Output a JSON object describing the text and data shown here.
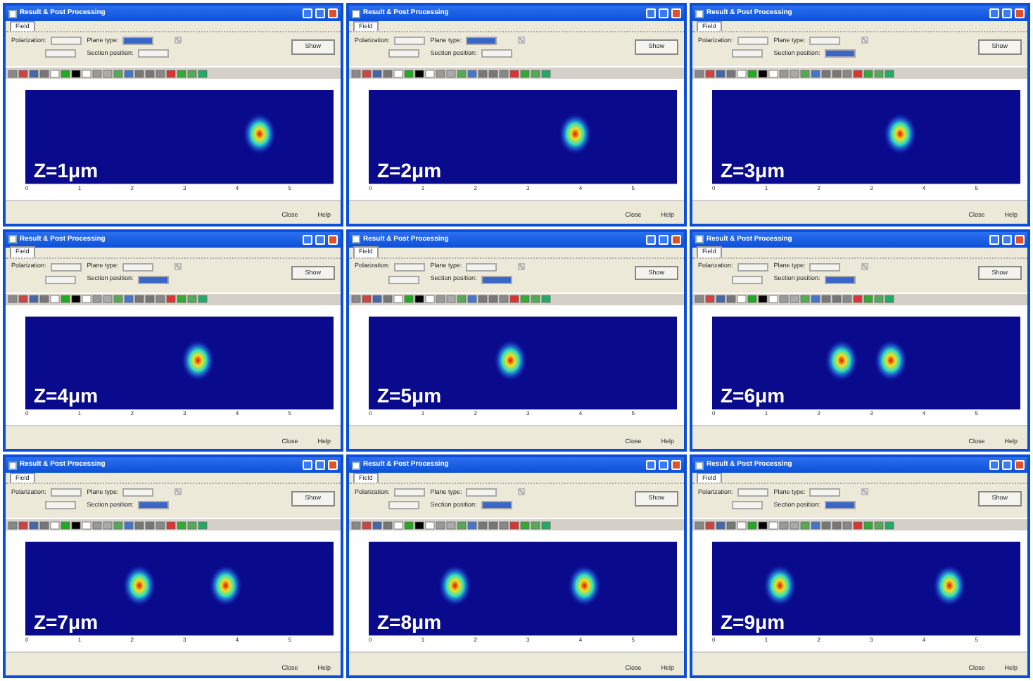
{
  "windows": [
    {
      "title": "Result & Post Processing",
      "tabs": [
        {
          "label": "Field",
          "selected": true
        }
      ],
      "polarization_label": "Polarization:",
      "plane_type_label": "Plane type:",
      "plane_type_field": {
        "focused": true
      },
      "section_position_label": "Section position:",
      "section_position_field": {
        "focused": false
      },
      "checkbox": {
        "checked": true,
        "disabled": true
      },
      "show_button": "Show",
      "overlay": "Z=1μm",
      "x_ticks": [
        "0",
        "1",
        "2",
        "3",
        "4",
        "5"
      ],
      "close_button": "Close",
      "help_button": "Help"
    },
    {
      "title": "Result & Post Processing",
      "tabs": [
        {
          "label": "Field",
          "selected": true
        }
      ],
      "polarization_label": "Polarization:",
      "plane_type_label": "Plane type:",
      "plane_type_field": {
        "focused": true
      },
      "section_position_label": "Section position:",
      "section_position_field": {
        "focused": false
      },
      "checkbox": {
        "checked": true,
        "disabled": true
      },
      "show_button": "Show",
      "overlay": "Z=2μm",
      "x_ticks": [
        "0",
        "1",
        "2",
        "3",
        "4",
        "5"
      ],
      "close_button": "Close",
      "help_button": "Help"
    },
    {
      "title": "Result & Post Processing",
      "tabs": [
        {
          "label": "Field",
          "selected": true
        }
      ],
      "polarization_label": "Polarization:",
      "plane_type_label": "Plane type:",
      "plane_type_field": {
        "focused": false
      },
      "section_position_label": "Section position:",
      "section_position_field": {
        "focused": true
      },
      "checkbox": {
        "checked": true,
        "disabled": true
      },
      "show_button": "Show",
      "overlay": "Z=3μm",
      "x_ticks": [
        "0",
        "1",
        "2",
        "3",
        "4",
        "5"
      ],
      "close_button": "Close",
      "help_button": "Help"
    },
    {
      "title": "Result & Post Processing",
      "tabs": [
        {
          "label": "Field",
          "selected": true
        }
      ],
      "polarization_label": "Polarization:",
      "plane_type_label": "Plane type:",
      "plane_type_field": {
        "focused": false
      },
      "section_position_label": "Section position:",
      "section_position_field": {
        "focused": true
      },
      "checkbox": {
        "checked": true,
        "disabled": true
      },
      "show_button": "Show",
      "overlay": "Z=4μm",
      "x_ticks": [
        "0",
        "1",
        "2",
        "3",
        "4",
        "5"
      ],
      "close_button": "Close",
      "help_button": "Help"
    },
    {
      "title": "Result & Post Processing",
      "tabs": [
        {
          "label": "Field",
          "selected": true
        }
      ],
      "polarization_label": "Polarization:",
      "plane_type_label": "Plane type:",
      "plane_type_field": {
        "focused": false
      },
      "section_position_label": "Section position:",
      "section_position_field": {
        "focused": true
      },
      "checkbox": {
        "checked": true,
        "disabled": true
      },
      "show_button": "Show",
      "overlay": "Z=5μm",
      "x_ticks": [
        "0",
        "1",
        "2",
        "3",
        "4",
        "5"
      ],
      "close_button": "Close",
      "help_button": "Help"
    },
    {
      "title": "Result & Post Processing",
      "tabs": [
        {
          "label": "Field",
          "selected": true
        }
      ],
      "polarization_label": "Polarization:",
      "plane_type_label": "Plane type:",
      "plane_type_field": {
        "focused": false
      },
      "section_position_label": "Section position:",
      "section_position_field": {
        "focused": true
      },
      "checkbox": {
        "checked": true,
        "disabled": true
      },
      "show_button": "Show",
      "overlay": "Z=6μm",
      "x_ticks": [
        "0",
        "1",
        "2",
        "3",
        "4",
        "5"
      ],
      "close_button": "Close",
      "help_button": "Help"
    },
    {
      "title": "Result & Post Processing",
      "tabs": [
        {
          "label": "Field",
          "selected": true
        }
      ],
      "polarization_label": "Polarization:",
      "plane_type_label": "Plane type:",
      "plane_type_field": {
        "focused": false
      },
      "section_position_label": "Section position:",
      "section_position_field": {
        "focused": true
      },
      "checkbox": {
        "checked": true,
        "disabled": true
      },
      "show_button": "Show",
      "overlay": "Z=7μm",
      "x_ticks": [
        "0",
        "1",
        "2",
        "3",
        "4",
        "5"
      ],
      "close_button": "Close",
      "help_button": "Help"
    },
    {
      "title": "Result & Post Processing",
      "tabs": [
        {
          "label": "Field",
          "selected": true
        }
      ],
      "polarization_label": "Polarization:",
      "plane_type_label": "Plane type:",
      "plane_type_field": {
        "focused": false
      },
      "section_position_label": "Section position:",
      "section_position_field": {
        "focused": true
      },
      "checkbox": {
        "checked": true,
        "disabled": true
      },
      "show_button": "Show",
      "overlay": "Z=8μm",
      "x_ticks": [
        "0",
        "1",
        "2",
        "3",
        "4",
        "5"
      ],
      "close_button": "Close",
      "help_button": "Help"
    },
    {
      "title": "Result & Post Processing",
      "tabs": [
        {
          "label": "Field",
          "selected": true
        }
      ],
      "polarization_label": "Polarization:",
      "plane_type_label": "Plane type:",
      "plane_type_field": {
        "focused": false
      },
      "section_position_label": "Section position:",
      "section_position_field": {
        "focused": true
      },
      "checkbox": {
        "checked": true,
        "disabled": true
      },
      "show_button": "Show",
      "overlay": "Z=9μm",
      "x_ticks": [
        "0",
        "1",
        "2",
        "3",
        "4",
        "5"
      ],
      "close_button": "Close",
      "help_button": "Help"
    }
  ]
}
